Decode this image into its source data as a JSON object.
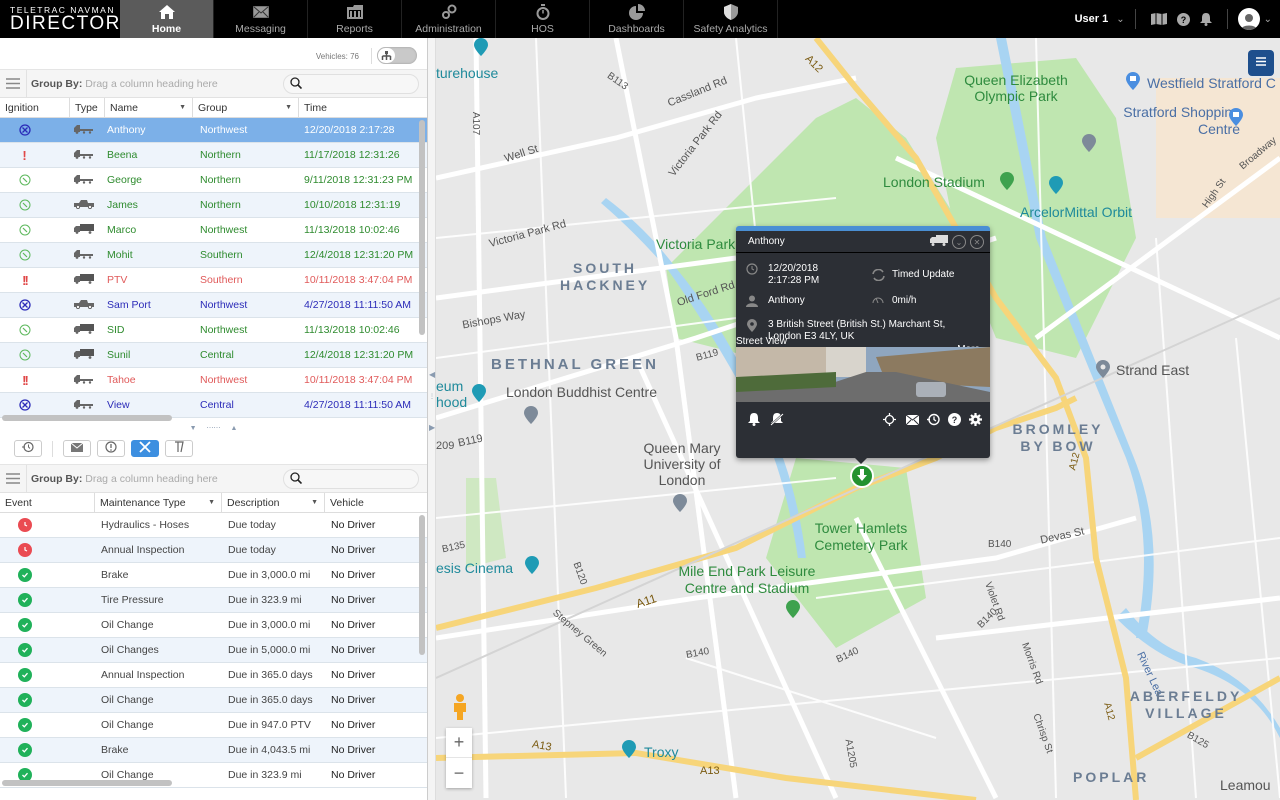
{
  "app": {
    "brand_line1": "TELETRAC NAVMAN",
    "brand_line2": "DIRECTOR"
  },
  "nav": {
    "items": [
      {
        "label": "Home",
        "icon": "home-icon",
        "active": true
      },
      {
        "label": "Messaging",
        "icon": "envelope-icon"
      },
      {
        "label": "Reports",
        "icon": "reports-icon"
      },
      {
        "label": "Administration",
        "icon": "gears-icon"
      },
      {
        "label": "HOS",
        "icon": "stopwatch-icon"
      },
      {
        "label": "Dashboards",
        "icon": "pie-chart-icon"
      },
      {
        "label": "Safety Analytics",
        "icon": "shield-icon"
      }
    ],
    "user_label": "User 1"
  },
  "vehicles_panel": {
    "vehicle_count": "Vehicles: 76",
    "group_by_label": "Group By:",
    "group_by_hint": "Drag a column heading here",
    "search_placeholder": "",
    "columns": [
      "Ignition",
      "Type",
      "Name",
      "Group",
      "Time"
    ],
    "rows": [
      {
        "ignition": "ignition-off",
        "type": "truck",
        "name": "Anthony",
        "group": "Northwest",
        "time": "12/20/2018 2:17:28",
        "status": "selected"
      },
      {
        "ignition": "alert",
        "type": "truck",
        "name": "Beena",
        "group": "Northern",
        "time": "11/17/2018 12:31:26",
        "status": "green"
      },
      {
        "ignition": "idle",
        "type": "truck",
        "name": "George",
        "group": "Northern",
        "time": "9/11/2018 12:31:23 PM",
        "status": "green"
      },
      {
        "ignition": "idle",
        "type": "pickup",
        "name": "James",
        "group": "Northern",
        "time": "10/10/2018 12:31:19",
        "status": "green"
      },
      {
        "ignition": "idle",
        "type": "box-truck",
        "name": "Marco",
        "group": "Northwest",
        "time": "11/13/2018 10:02:46",
        "status": "green"
      },
      {
        "ignition": "idle",
        "type": "truck",
        "name": "Mohit",
        "group": "Southern",
        "time": "12/4/2018 12:31:20 PM",
        "status": "green"
      },
      {
        "ignition": "double-alert",
        "type": "box-truck",
        "name": "PTV",
        "group": "Southern",
        "time": "10/11/2018 3:47:04 PM",
        "status": "red"
      },
      {
        "ignition": "ignition-off",
        "type": "pickup",
        "name": "Sam Port",
        "group": "Northwest",
        "time": "4/27/2018 11:11:50 AM",
        "status": "blue"
      },
      {
        "ignition": "idle",
        "type": "box-truck",
        "name": "SID",
        "group": "Northwest",
        "time": "11/13/2018 10:02:46",
        "status": "green"
      },
      {
        "ignition": "idle",
        "type": "box-truck",
        "name": "Sunil",
        "group": "Central",
        "time": "12/4/2018 12:31:20 PM",
        "status": "green"
      },
      {
        "ignition": "double-alert",
        "type": "truck",
        "name": "Tahoe",
        "group": "Northwest",
        "time": "10/11/2018 3:47:04 PM",
        "status": "red"
      },
      {
        "ignition": "ignition-off",
        "type": "truck",
        "name": "View",
        "group": "Central",
        "time": "4/27/2018 11:11:50 AM",
        "status": "blue"
      }
    ]
  },
  "bottom_tabs": [
    {
      "name": "history",
      "icon": "history-icon"
    },
    {
      "name": "messages",
      "icon": "envelope-icon"
    },
    {
      "name": "alerts",
      "icon": "alert-icon"
    },
    {
      "name": "maintenance",
      "icon": "tools-icon",
      "active": true
    },
    {
      "name": "geofence",
      "icon": "route-icon"
    }
  ],
  "maintenance_panel": {
    "group_by_label": "Group By:",
    "group_by_hint": "Drag a column heading here",
    "columns": [
      "Event",
      "Maintenance Type",
      "Description",
      "Vehicle"
    ],
    "rows": [
      {
        "event": "overdue",
        "type": "Hydraulics - Hoses",
        "desc": "Due today",
        "vehicle": "No Driver"
      },
      {
        "event": "overdue",
        "type": "Annual Inspection",
        "desc": "Due today",
        "vehicle": "No Driver"
      },
      {
        "event": "ok",
        "type": "Brake",
        "desc": "Due in 3,000.0 mi",
        "vehicle": "No Driver"
      },
      {
        "event": "ok",
        "type": "Tire Pressure",
        "desc": "Due in 323.9 mi",
        "vehicle": "No Driver"
      },
      {
        "event": "ok",
        "type": "Oil Change",
        "desc": "Due in 3,000.0 mi",
        "vehicle": "No Driver"
      },
      {
        "event": "ok",
        "type": "Oil Changes",
        "desc": "Due in 5,000.0 mi",
        "vehicle": "No Driver"
      },
      {
        "event": "ok",
        "type": "Annual Inspection",
        "desc": "Due in 365.0 days",
        "vehicle": "No Driver"
      },
      {
        "event": "ok",
        "type": "Oil Change",
        "desc": "Due in 365.0 days",
        "vehicle": "No Driver"
      },
      {
        "event": "ok",
        "type": "Oil Change",
        "desc": "Due in 947.0 PTV",
        "vehicle": "No Driver"
      },
      {
        "event": "ok",
        "type": "Brake",
        "desc": "Due in 4,043.5 mi",
        "vehicle": "No Driver"
      },
      {
        "event": "ok",
        "type": "Oil Change",
        "desc": "Due in 323.9 mi",
        "vehicle": "No Driver"
      }
    ]
  },
  "popup": {
    "title": "Anthony",
    "date": "12/20/2018",
    "time": "2:17:28 PM",
    "update_type": "Timed Update",
    "driver": "Anthony",
    "speed": "0mi/h",
    "address_line1": "3 British Street (British St.) Marchant St,",
    "address_line2": "London E3 4LY, UK",
    "more_label": "More",
    "street_view_label": "Street View"
  },
  "map": {
    "zoom_in": "+",
    "zoom_out": "−",
    "labels": {
      "turehouse": "turehouse",
      "cassland": "Cassland Rd",
      "b113": "B113",
      "a12_top": "A12",
      "well_st": "Well St",
      "a107": "A107",
      "victoria_park_rd": "Victoria Park Rd",
      "victoria_park_rd2": "Victoria Park Rd",
      "victoria_park": "Victoria Park",
      "qeop": "Queen Elizabeth Olympic Park",
      "westfield": "Westfield Stratford C",
      "stratford_sc": "Stratford Shopping Centre",
      "london_stadium": "London Stadium",
      "arcelor": "ArcelorMittal Orbit",
      "high_st": "High St",
      "broadway": "Broadway",
      "south_hackney": "SOUTH HACKNEY",
      "old_ford": "Old Ford Rd",
      "bishops_way": "Bishops Way",
      "bethnal_green": "BETHNAL GREEN",
      "b119": "B119",
      "b119b": "B119",
      "museum": "eum hood",
      "buddhist": "London Buddhist Centre",
      "a209": "209",
      "queen_mary": "Queen Mary University of London",
      "strand_east": "Strand East",
      "bromley": "BROMLEY BY BOW",
      "a12_mid": "A12",
      "b135": "B135",
      "b120": "B120",
      "a11": "A11",
      "cinema": "esis Cinema",
      "tower_hamlets": "Tower Hamlets Cemetery Park",
      "mile_end": "Mile End Park Leisure Centre and Stadium",
      "stepney": "Stepney Green",
      "b140a": "B140",
      "b140b": "B140",
      "b140c": "B140",
      "devas": "Devas St",
      "violet": "Violet Rd",
      "morris": "Morris Rd",
      "chrisp": "Chrisp St",
      "river_lea": "River Lea",
      "a12_low": "A12",
      "aberfeldy": "ABERFELDY VILLAGE",
      "b125": "B125",
      "poplar": "POPLAR",
      "leamouth": "Leamou",
      "a13": "A13",
      "a13b": "A13",
      "troxy": "Troxy",
      "a1205": "A1205"
    }
  }
}
